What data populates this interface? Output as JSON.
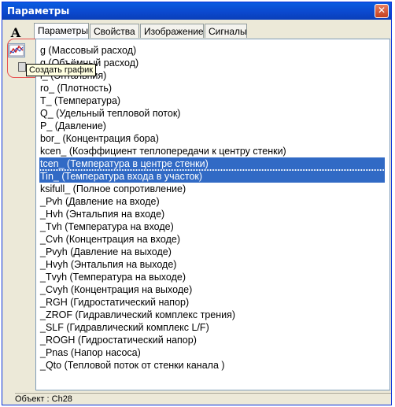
{
  "window": {
    "title": "Параметры",
    "close_label": "✕"
  },
  "toolbar": {
    "font_button_label": "A",
    "create_chart_tooltip": "Создать график"
  },
  "tabs": [
    {
      "label": "Параметры",
      "active": true
    },
    {
      "label": "Свойства",
      "active": false
    },
    {
      "label": "Изображение",
      "active": false
    },
    {
      "label": "Сигналы",
      "active": false
    }
  ],
  "parameters": [
    {
      "label": "g (Массовый расход)",
      "selected": false
    },
    {
      "label": "g (Объёмный расход)",
      "selected": false
    },
    {
      "label": "i_ (Энтальпия)",
      "selected": false
    },
    {
      "label": "ro_ (Плотность)",
      "selected": false
    },
    {
      "label": "T_ (Температура)",
      "selected": false
    },
    {
      "label": "Q_ (Удельный тепловой поток)",
      "selected": false
    },
    {
      "label": "P_ (Давление)",
      "selected": false
    },
    {
      "label": "bor_ (Концентрация бора)",
      "selected": false
    },
    {
      "label": "kcen_ (Коэффициент теплопередачи к центру стенки)",
      "selected": false
    },
    {
      "label": "tcen_ (Температура в центре стенки)",
      "selected": true
    },
    {
      "label": "Tin_ (Температура входа в участок)",
      "selected": true
    },
    {
      "label": "ksifull_ (Полное сопротивление)",
      "selected": false
    },
    {
      "label": "_Pvh (Давление на входе)",
      "selected": false
    },
    {
      "label": "_Hvh (Энтальпия на входе)",
      "selected": false
    },
    {
      "label": "_Tvh (Температура на входе)",
      "selected": false
    },
    {
      "label": "_Cvh (Концентрация на входе)",
      "selected": false
    },
    {
      "label": "_Pvyh (Давление на выходе)",
      "selected": false
    },
    {
      "label": "_Hvyh (Энтальпия на выходе)",
      "selected": false
    },
    {
      "label": "_Tvyh (Температура на выходе)",
      "selected": false
    },
    {
      "label": "_Cvyh (Концентрация на выходе)",
      "selected": false
    },
    {
      "label": "_RGH (Гидростатический напор)",
      "selected": false
    },
    {
      "label": "_ZROF (Гидравлический комплекс трения)",
      "selected": false
    },
    {
      "label": "_SLF (Гидравлический комплекс L/F)",
      "selected": false
    },
    {
      "label": "_ROGH (Гидростатический напор)",
      "selected": false
    },
    {
      "label": "_Pnas (Напор насоса)",
      "selected": false
    },
    {
      "label": "_Qto (Тепловой поток от стенки канала )",
      "selected": false
    }
  ],
  "status": {
    "text": "Объект : Ch28"
  }
}
